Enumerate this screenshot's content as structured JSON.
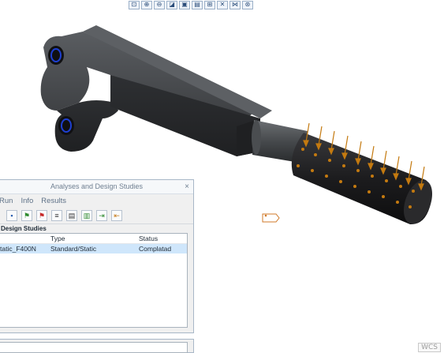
{
  "dialog": {
    "title": "Analyses and Design Studies",
    "close_label": "×",
    "menu": [
      "Run",
      "Info",
      "Results"
    ],
    "section_label": "Design Studies",
    "columns": [
      "",
      "Type",
      "Status"
    ],
    "rows": [
      {
        "name": "tatic_F400N",
        "type": "Standard/Static",
        "status": "Complatad"
      }
    ],
    "toolbar_icons": [
      "new-analysis-icon",
      "flag-green-icon",
      "flag-red-icon",
      "info-icon",
      "report-icon",
      "results-icon",
      "export-icon",
      "import-icon"
    ]
  },
  "viewport": {
    "wcs_label": "WCS",
    "toolbar_icons": [
      "refit-icon",
      "zoom-in-icon",
      "zoom-out-icon",
      "repaint-icon",
      "display-style-icon",
      "saved-views-icon",
      "datum-display-icon",
      "csys-display-icon",
      "annotation-display-icon",
      "spin-center-icon"
    ]
  },
  "colors": {
    "part": "#3d3f42",
    "grip": "#1b1b1d",
    "load_arrow": "#c47a10",
    "selection_row": "#cfe6fb"
  }
}
